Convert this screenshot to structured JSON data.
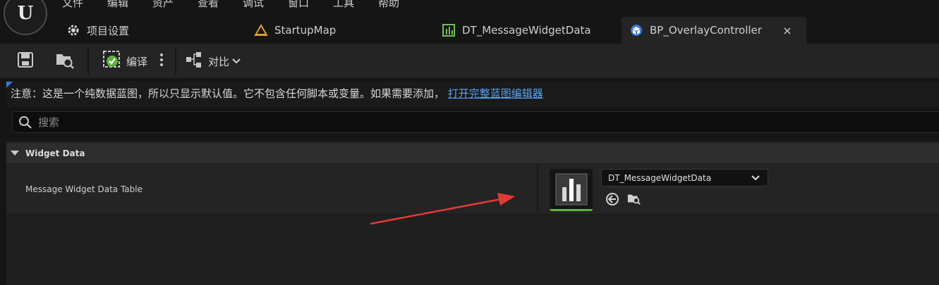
{
  "menu": [
    "文件",
    "编辑",
    "资产",
    "查看",
    "调试",
    "窗口",
    "工具",
    "帮助"
  ],
  "tabs": [
    {
      "label": "项目设置",
      "icon": "gear-icon"
    },
    {
      "label": "StartupMap",
      "icon": "level-map-icon"
    },
    {
      "label": "DT_MessageWidgetData",
      "icon": "data-table-icon"
    },
    {
      "label": "BP_OverlayController",
      "icon": "blueprint-icon",
      "active": true,
      "close": "×"
    }
  ],
  "toolbar": {
    "compile_label": "编译",
    "diff_label": "对比"
  },
  "notice": {
    "text": "注意：这是一个纯数据蓝图，所以只显示默认值。它不包含任何脚本或变量。如果需要添加，",
    "link": "打开完整蓝图编辑器"
  },
  "search": {
    "placeholder": "搜索"
  },
  "details": {
    "category": "Widget Data",
    "property_name": "Message Widget Data Table",
    "property_value": "DT_MessageWidgetData"
  },
  "colors": {
    "accent_blue": "#3a78d6",
    "link_blue": "#5aa3f0",
    "compile_ok_green": "#5bb33a",
    "annotation_arrow": "#e53935"
  }
}
